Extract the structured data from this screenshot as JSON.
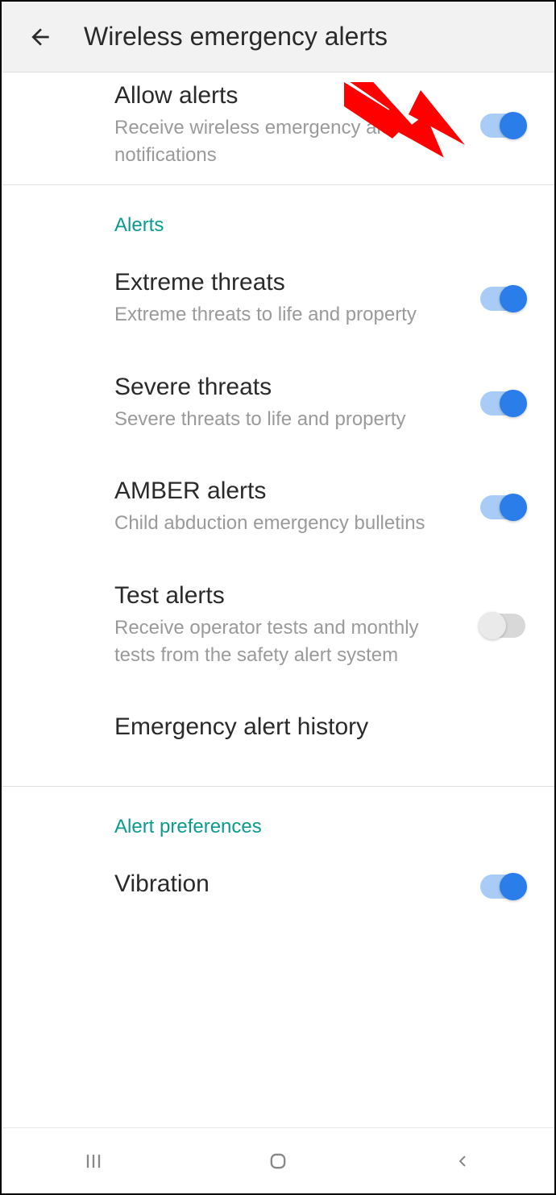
{
  "header": {
    "title": "Wireless emergency alerts"
  },
  "allowAlerts": {
    "title": "Allow alerts",
    "desc": "Receive wireless emergency alert notifications"
  },
  "sections": {
    "alerts": "Alerts",
    "preferences": "Alert preferences"
  },
  "items": {
    "extreme": {
      "title": "Extreme threats",
      "desc": "Extreme threats to life and property"
    },
    "severe": {
      "title": "Severe threats",
      "desc": "Severe threats to life and property"
    },
    "amber": {
      "title": "AMBER alerts",
      "desc": "Child abduction emergency bulletins"
    },
    "test": {
      "title": "Test alerts",
      "desc": "Receive operator tests and monthly tests from the safety alert system"
    },
    "history": {
      "title": "Emergency alert history"
    },
    "vibration": {
      "title": "Vibration"
    }
  }
}
